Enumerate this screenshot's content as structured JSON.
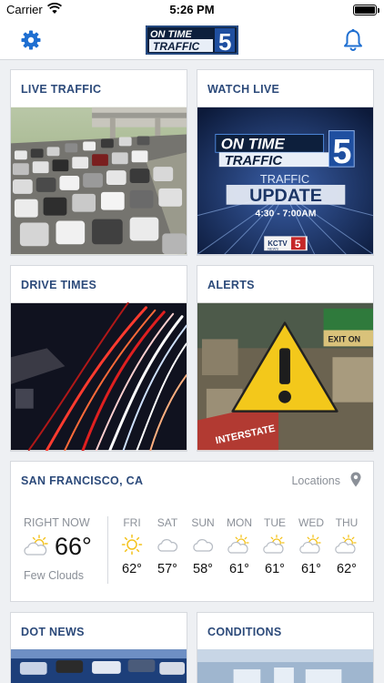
{
  "status": {
    "carrier": "Carrier",
    "time": "5:26 PM"
  },
  "nav": {
    "logo_line1": "ON TIME",
    "logo_line2": "TRAFFIC",
    "logo_num": "5"
  },
  "tiles": {
    "live_traffic": "LIVE TRAFFIC",
    "watch_live": "WATCH LIVE",
    "drive_times": "DRIVE TIMES",
    "alerts": "ALERTS",
    "dot_news": "DOT NEWS",
    "conditions": "CONDITIONS"
  },
  "promo": {
    "line1": "ON TIME",
    "line2": "TRAFFIC",
    "num": "5",
    "line3": "TRAFFIC",
    "line4": "UPDATE",
    "hours": "4:30 - 7:00AM",
    "station": "KCTV",
    "station_sub": "NEWS",
    "station_num": "5"
  },
  "alerts_image": {
    "sign1": "EXIT ON",
    "sign2": "INTERSTATE"
  },
  "weather": {
    "city": "SAN FRANCISCO, CA",
    "locations_label": "Locations",
    "now_label": "RIGHT NOW",
    "now_temp": "66°",
    "now_condition": "Few Clouds",
    "now_icon": "partly-cloudy-icon",
    "forecast": [
      {
        "day": "FRI",
        "temp": "62°",
        "icon": "sun-icon"
      },
      {
        "day": "SAT",
        "temp": "57°",
        "icon": "cloud-icon"
      },
      {
        "day": "SUN",
        "temp": "58°",
        "icon": "cloud-icon"
      },
      {
        "day": "MON",
        "temp": "61°",
        "icon": "partly-cloudy-icon"
      },
      {
        "day": "TUE",
        "temp": "61°",
        "icon": "partly-cloudy-icon"
      },
      {
        "day": "WED",
        "temp": "61°",
        "icon": "partly-cloudy-icon"
      },
      {
        "day": "THU",
        "temp": "62°",
        "icon": "partly-cloudy-icon"
      }
    ]
  },
  "colors": {
    "title_blue": "#2c4a7a",
    "accent_blue": "#1f6fd1",
    "icon_yellow": "#f4c21c"
  }
}
